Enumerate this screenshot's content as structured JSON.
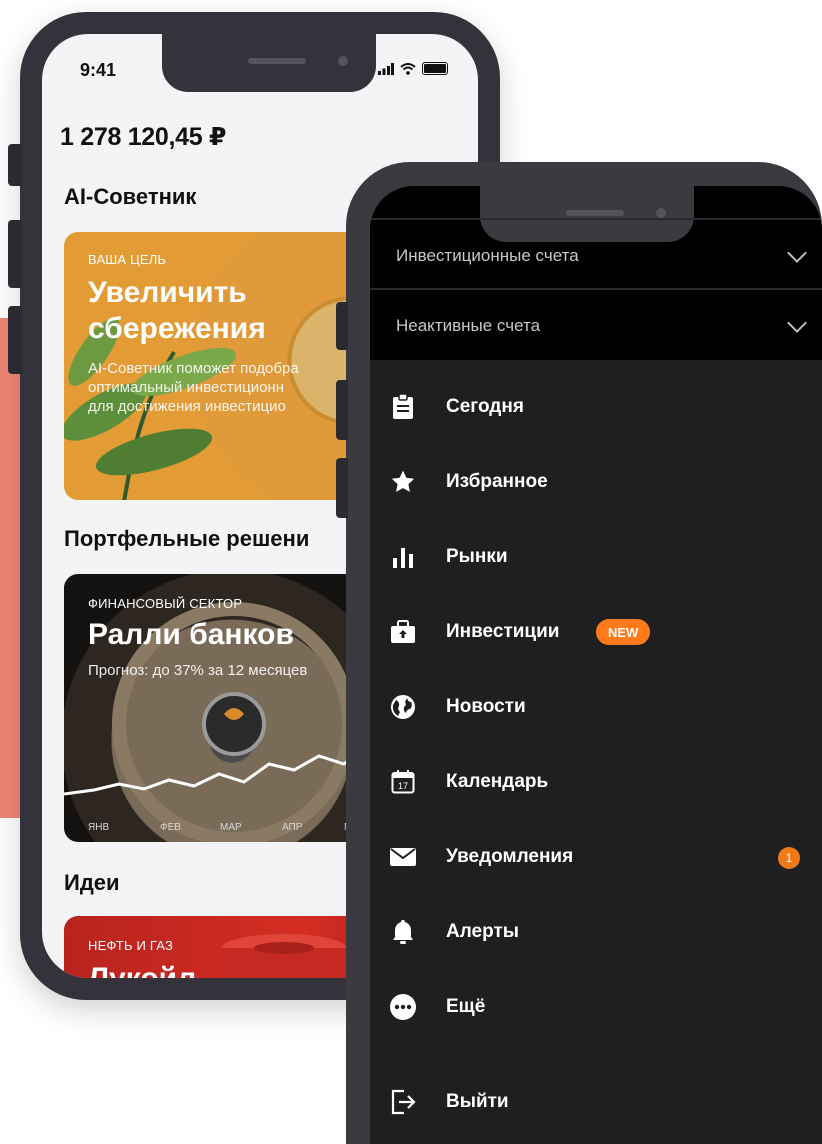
{
  "back_phone": {
    "status": {
      "time": "9:41"
    },
    "balance": "1 278 120,45 ₽",
    "sections": {
      "ai": "AI-Советник",
      "portfolio": "Портфельные решени",
      "ideas": "Идеи"
    },
    "cards": {
      "ai": {
        "tag": "ВАША ЦЕЛЬ",
        "title_line1": "Увеличить",
        "title_line2": "сбережения",
        "desc_line1": "AI-Советник поможет подобра",
        "desc_line2": "оптимальный инвестиционн",
        "desc_line3": "для достижения инвестицио"
      },
      "bank": {
        "tag": "ФИНАНСОВЫЙ СЕКТОР",
        "title": "Ралли банков",
        "desc": "Прогноз: до 37% за 12 месяцев",
        "months": [
          "ЯНВ",
          "ФЕВ",
          "МАР",
          "АПР",
          "М"
        ]
      },
      "oil": {
        "tag": "НЕФТЬ И ГАЗ",
        "title": "Лукойл"
      }
    }
  },
  "front_phone": {
    "accounts": [
      {
        "label": "Инвестиционные счета"
      },
      {
        "label": "Неактивные счета"
      }
    ],
    "menu": [
      {
        "label": "Сегодня",
        "icon": "clipboard-icon"
      },
      {
        "label": "Избранное",
        "icon": "star-icon"
      },
      {
        "label": "Рынки",
        "icon": "bar-chart-icon"
      },
      {
        "label": "Инвестиции",
        "icon": "briefcase-icon",
        "badge": "NEW"
      },
      {
        "label": "Новости",
        "icon": "globe-icon"
      },
      {
        "label": "Календарь",
        "icon": "calendar-icon",
        "icon_text": "17"
      },
      {
        "label": "Уведомления",
        "icon": "mail-icon",
        "count": "1"
      },
      {
        "label": "Алерты",
        "icon": "bell-icon"
      },
      {
        "label": "Ещё",
        "icon": "more-icon"
      },
      {
        "label": "Выйти",
        "icon": "logout-icon"
      }
    ]
  },
  "colors": {
    "accent": "#ff7a1a",
    "salmon": "#f08674",
    "menu_bg": "#1f1f22"
  }
}
